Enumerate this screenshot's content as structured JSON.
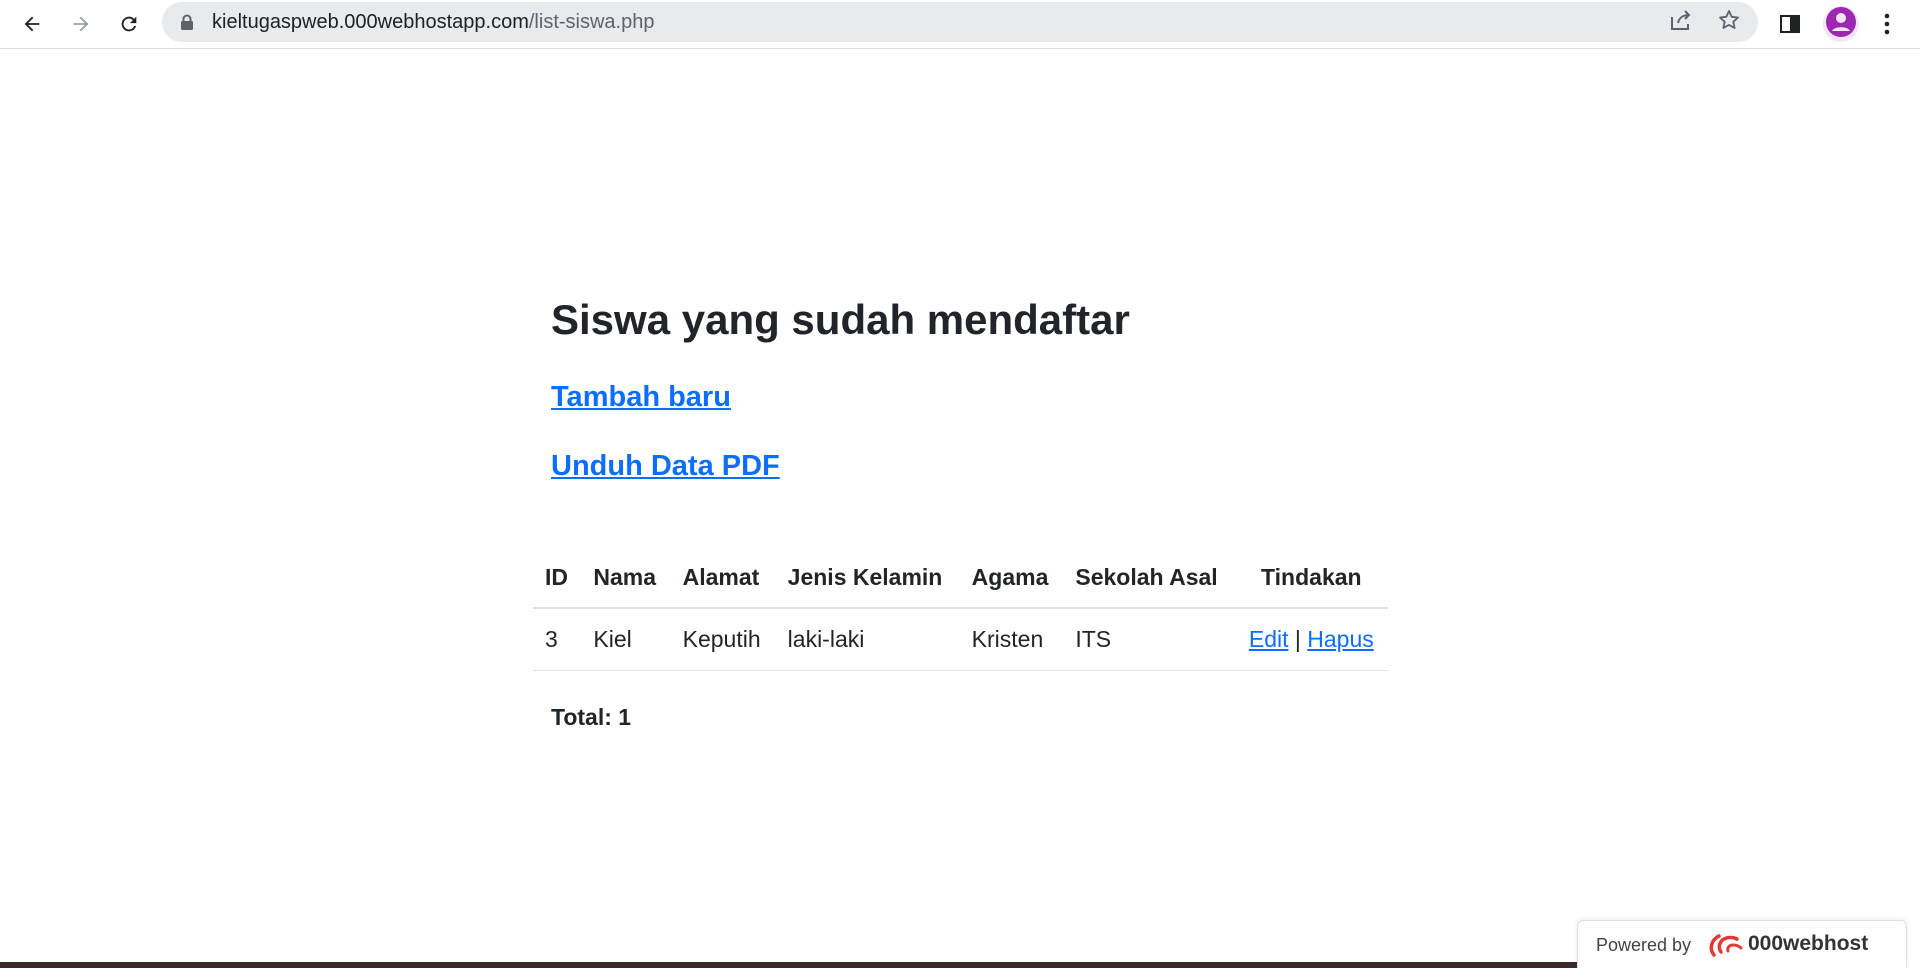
{
  "browser": {
    "url_host": "kieltugaspweb.000webhostapp.com",
    "url_path": "/list-siswa.php",
    "icons": [
      "back-icon",
      "forward-icon",
      "reload-icon",
      "lock-icon",
      "share-icon",
      "star-icon",
      "side-panel-icon",
      "avatar-icon",
      "menu-icon"
    ]
  },
  "page": {
    "title": "Siswa yang sudah mendaftar",
    "link_add": "Tambah baru",
    "link_pdf": "Unduh Data PDF",
    "table": {
      "headers": [
        "ID",
        "Nama",
        "Alamat",
        "Jenis Kelamin",
        "Agama",
        "Sekolah Asal",
        "Tindakan"
      ],
      "rows": [
        {
          "id": "3",
          "nama": "Kiel",
          "alamat": "Keputih",
          "jenis_kelamin": "laki-laki",
          "agama": "Kristen",
          "sekolah_asal": "ITS",
          "edit_label": "Edit",
          "separator": "|",
          "hapus_label": "Hapus"
        }
      ]
    },
    "total": "Total: 1"
  },
  "badge": {
    "powered_text": "Powered by",
    "brand": "000webhost"
  },
  "colors": {
    "link": "#0d6efd",
    "text": "#212529",
    "omnibox": "#e8eaed",
    "avatar": "#9c27b0"
  }
}
